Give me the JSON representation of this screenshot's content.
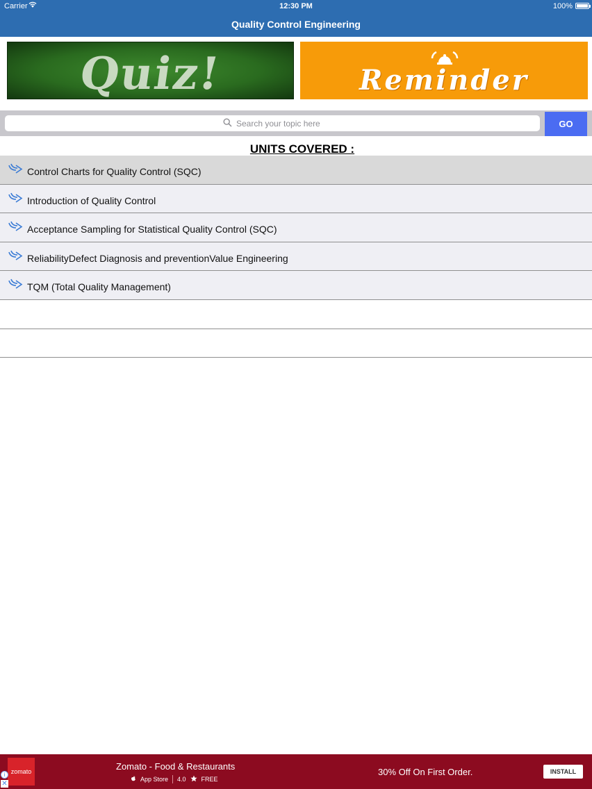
{
  "status": {
    "carrier": "Carrier",
    "time": "12:30 PM",
    "battery": "100%"
  },
  "nav": {
    "title": "Quality Control Engineering"
  },
  "banners": {
    "quiz_text": "Quiz!",
    "reminder_text": "Reminder"
  },
  "search": {
    "placeholder": "Search your topic here",
    "go_label": "GO"
  },
  "units": {
    "title": "UNITS COVERED :",
    "items": [
      "Control Charts for Quality Control (SQC)",
      "Introduction of Quality Control",
      "Acceptance Sampling for Statistical Quality Control (SQC)",
      "ReliabilityDefect Diagnosis and preventionValue Engineering",
      "TQM (Total Quality Management)"
    ]
  },
  "ad": {
    "logo_text": "zomato",
    "title": "Zomato - Food & Restaurants",
    "store": "App Store",
    "rating": "4.0",
    "price": "FREE",
    "offer": "30% Off On First Order.",
    "install_label": "INSTALL"
  },
  "colors": {
    "nav_bar": "#2d6db1",
    "go_button": "#4b6cf2",
    "ad_bg": "#8c0b20",
    "reminder_bg": "#f79b09"
  }
}
